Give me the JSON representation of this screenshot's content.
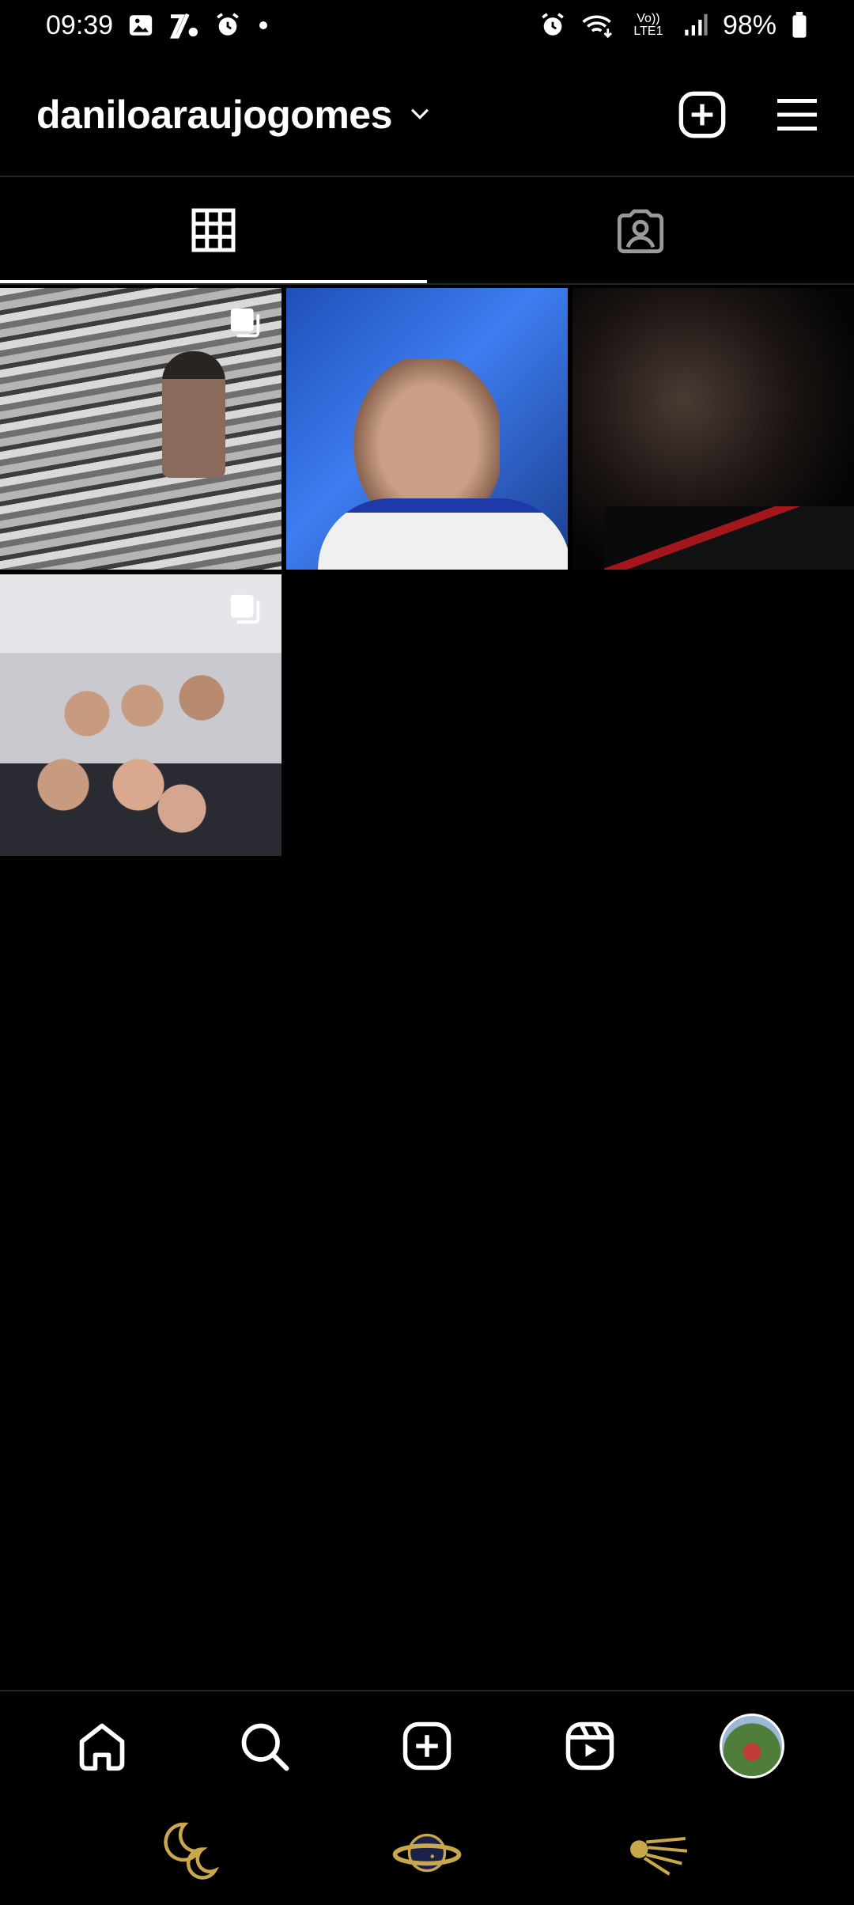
{
  "status_bar": {
    "time": "09:39",
    "battery": "98%",
    "network": "Vo)) LTE1",
    "icons_left": [
      "gallery-icon",
      "sport-app-icon",
      "alarm-icon",
      "dot-icon"
    ],
    "icons_right": [
      "alarm-icon",
      "wifi-icon",
      "lte-icon",
      "signal-icon",
      "battery-icon"
    ]
  },
  "header": {
    "username": "daniloaraujogomes",
    "dropdown_icon": "chevron-down-icon",
    "new_post_icon": "add-square-icon",
    "menu_icon": "hamburger-menu-icon"
  },
  "tabs": [
    {
      "icon": "grid-icon",
      "active": true
    },
    {
      "icon": "tagged-person-icon",
      "active": false
    }
  ],
  "posts": [
    {
      "subject": "beach-waves-photo",
      "multi": true
    },
    {
      "subject": "selfie-blue-background",
      "multi": false
    },
    {
      "subject": "dark-portrait",
      "multi": false
    },
    {
      "subject": "group-photo",
      "multi": true
    }
  ],
  "bottom_nav": [
    {
      "icon": "home-icon"
    },
    {
      "icon": "search-icon"
    },
    {
      "icon": "create-icon"
    },
    {
      "icon": "reels-icon"
    },
    {
      "icon": "profile-avatar"
    }
  ],
  "system_nav": [
    {
      "icon": "moon-icon"
    },
    {
      "icon": "planet-icon"
    },
    {
      "icon": "comet-icon"
    }
  ],
  "colors": {
    "background": "#000000",
    "text": "#ffffff",
    "divider": "#262626",
    "system_nav_gold": "#c9a84c"
  }
}
